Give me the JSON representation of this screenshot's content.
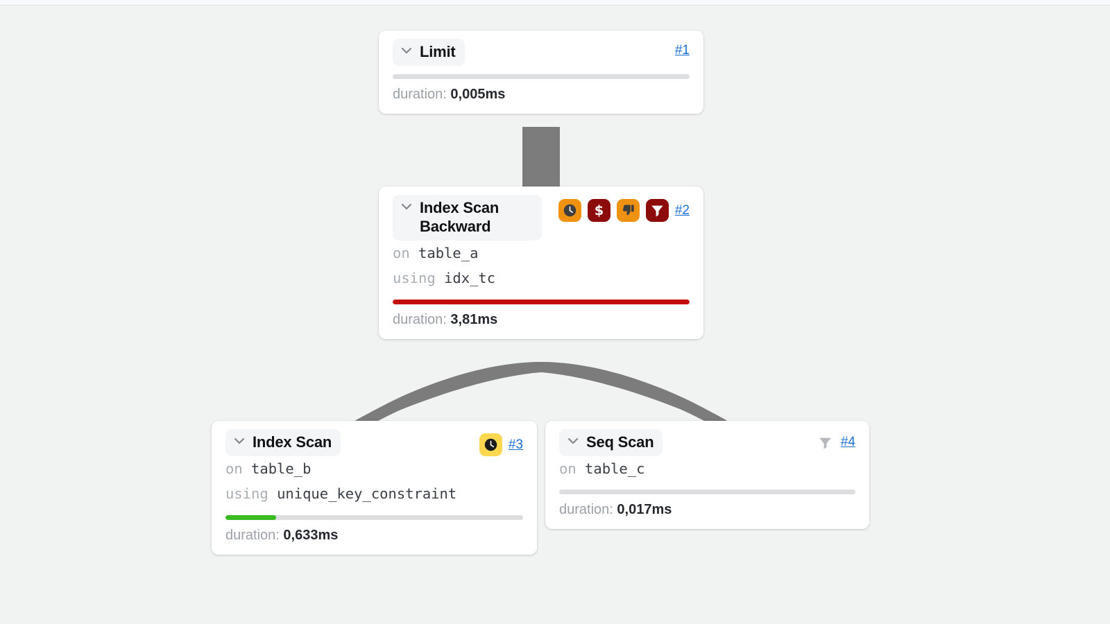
{
  "graph": {
    "edge_color": "#7c7c7c",
    "background": "#f1f2f2"
  },
  "colors": {
    "link": "#1a6fd4",
    "bar_track": "#dcdedf",
    "bar_green": "#3cba22",
    "bar_red": "#c20b0b",
    "badge_orange": "#ef9211",
    "badge_darkred": "#8c0b0b",
    "badge_yellow": "#fbd850",
    "badge_gray": "#b3b6ba",
    "badge_icon_dark": "#3f3f3f",
    "chip_bg": "#f4f5f7"
  },
  "nodes": [
    {
      "id": "node-1",
      "title": "Limit",
      "ref": "#1",
      "chevron_icon": "chevron-down-icon",
      "badges": [],
      "details": [],
      "bar": {
        "percent": 0,
        "color_key": "bar_track"
      },
      "duration_label": "duration:",
      "duration_value": "0,005ms"
    },
    {
      "id": "node-2",
      "title": "Index Scan Backward",
      "ref": "#2",
      "chevron_icon": "chevron-down-icon",
      "badges": [
        {
          "icon": "clock-icon",
          "style": "orange"
        },
        {
          "icon": "dollar-icon",
          "style": "darkred"
        },
        {
          "icon": "thumbs-down-icon",
          "style": "orange"
        },
        {
          "icon": "filter-icon",
          "style": "darkred"
        }
      ],
      "details": [
        {
          "key": "on",
          "value": "table_a"
        },
        {
          "key": "using",
          "value": "idx_tc"
        }
      ],
      "bar": {
        "percent": 100,
        "color_key": "bar_red"
      },
      "duration_label": "duration:",
      "duration_value": "3,81ms"
    },
    {
      "id": "node-3",
      "title": "Index Scan",
      "ref": "#3",
      "chevron_icon": "chevron-down-icon",
      "badges": [
        {
          "icon": "clock-icon",
          "style": "yellow"
        }
      ],
      "details": [
        {
          "key": "on",
          "value": "table_b"
        },
        {
          "key": "using",
          "value": "unique_key_constraint"
        }
      ],
      "bar": {
        "percent": 17,
        "color_key": "bar_green"
      },
      "duration_label": "duration:",
      "duration_value": "0,633ms"
    },
    {
      "id": "node-4",
      "title": "Seq Scan",
      "ref": "#4",
      "chevron_icon": "chevron-down-icon",
      "badges": [
        {
          "icon": "filter-icon",
          "style": "plain-gray"
        }
      ],
      "details": [
        {
          "key": "on",
          "value": "table_c"
        }
      ],
      "bar": {
        "percent": 0,
        "color_key": "bar_track"
      },
      "duration_label": "duration:",
      "duration_value": "0,017ms"
    }
  ],
  "edges": [
    {
      "from": "node-1",
      "to": "node-2",
      "name": "edge-1-to-2"
    },
    {
      "from": "node-2",
      "to": "node-3",
      "name": "edge-2-to-3"
    },
    {
      "from": "node-2",
      "to": "node-4",
      "name": "edge-2-to-4"
    }
  ]
}
